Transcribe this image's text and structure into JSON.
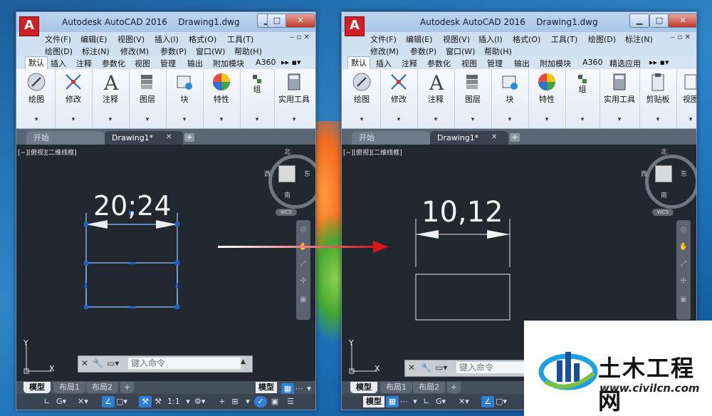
{
  "colors": {
    "accent": "#2e7ed6",
    "canvas": "#212830",
    "arrow": "#d8181f",
    "dim_selected": "#7fa9e8"
  },
  "window_title": "Autodesk AutoCAD 2016",
  "document_name": "Drawing1.dwg",
  "left": {
    "menu_row1": [
      "文件(F)",
      "编辑(E)",
      "视图(V)",
      "插入(I)",
      "格式(O)",
      "工具(T)"
    ],
    "menu_row2": [
      "绘图(D)",
      "标注(N)",
      "修改(M)",
      "参数(P)",
      "窗口(W)",
      "帮助(H)"
    ],
    "ribbon_tabs": [
      "默认",
      "插入",
      "注释",
      "参数化",
      "视图",
      "管理",
      "输出",
      "附加模块",
      "A360"
    ],
    "panels": [
      "绘图",
      "修改",
      "注释",
      "图层",
      "块",
      "特性",
      "组",
      "实用工具"
    ],
    "doc_tabs": [
      "开始",
      "Drawing1*"
    ],
    "view_label": "[−][俯视][二维线框]",
    "compass": {
      "n": "北",
      "s": "南",
      "e": "东",
      "w": "西",
      "cube_label": "上",
      "wcs": "WCS"
    },
    "dimension": "20;24",
    "cmd_placeholder": "键入命令",
    "layout_tabs": [
      "模型",
      "布局1",
      "布局2"
    ],
    "model_label": "模型",
    "scale": "1:1"
  },
  "right": {
    "menu_row1": [
      "文件(F)",
      "编辑(E)",
      "视图(V)",
      "插入(I)",
      "格式(O)",
      "工具(T)",
      "绘图(D)",
      "标注(N)"
    ],
    "menu_row2": [
      "修改(M)",
      "参数(P)",
      "窗口(W)",
      "帮助(H)"
    ],
    "ribbon_tabs": [
      "默认",
      "插入",
      "注释",
      "参数化",
      "视图",
      "管理",
      "输出",
      "附加模块",
      "A360",
      "精选应用"
    ],
    "panels": [
      "绘图",
      "修改",
      "注释",
      "图层",
      "块",
      "特性",
      "组",
      "实用工具",
      "剪贴板",
      "视图"
    ],
    "doc_tabs": [
      "开始",
      "Drawing1*"
    ],
    "view_label": "[−][俯视][二维线框]",
    "compass": {
      "n": "北",
      "s": "南",
      "e": "东",
      "w": "西",
      "cube_label": "上",
      "wcs": "WCS"
    },
    "dimension": "10,12",
    "cmd_placeholder": "键入命令",
    "layout_tabs": [
      "模型",
      "布局1",
      "布局2"
    ],
    "model_label": "模型"
  },
  "ucs": {
    "x": "X",
    "y": "Y"
  },
  "watermark": {
    "name": "土木工程网",
    "url": "www.civilcn.com"
  }
}
